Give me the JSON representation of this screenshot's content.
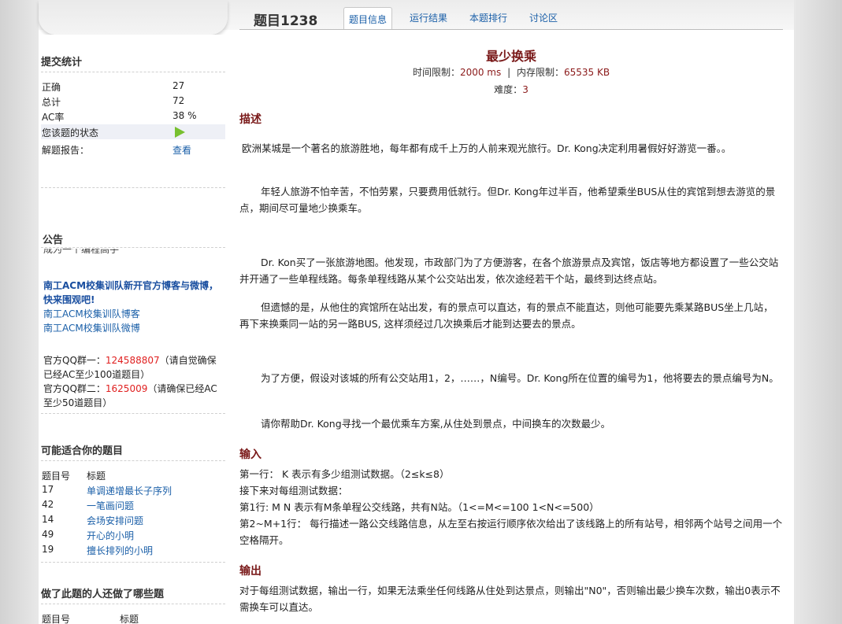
{
  "header": {
    "problem_id": "题目1238",
    "tabs": [
      {
        "label": "题目信息",
        "active": true
      },
      {
        "label": "运行结果",
        "active": false
      },
      {
        "label": "本题排行",
        "active": false
      },
      {
        "label": "讨论区",
        "active": false
      }
    ]
  },
  "stats": {
    "title": "提交统计",
    "rows": [
      {
        "label": "正确",
        "value": "27"
      },
      {
        "label": "总计",
        "value": "72"
      },
      {
        "label": "AC率",
        "value": "38 %"
      }
    ],
    "status_label": "您该题的状态",
    "report_label": "解题报告：",
    "report_link": "查看"
  },
  "notice": {
    "title": "公告",
    "cut_text": "成为一个编程高手",
    "links": [
      "南工ACM校集训队新开官方博客与微博，快来围观吧!",
      "南工ACM校集训队博客",
      "南工ACM校集训队微博"
    ],
    "qq1_label": "官方QQ群一：",
    "qq1_number": "124588807",
    "qq1_note": "（请自觉确保已经AC至少100道题目）",
    "qq2_label": "官方QQ群二：",
    "qq2_number": "1625009",
    "qq2_note": "（请确保已经AC至少50道题目）"
  },
  "suggested": {
    "title": "可能适合你的题目",
    "col_id": "题目号",
    "col_title": "标题",
    "rows": [
      {
        "id": "17",
        "title": "单调递增最长子序列"
      },
      {
        "id": "42",
        "title": "一笔画问题"
      },
      {
        "id": "14",
        "title": "会场安排问题"
      },
      {
        "id": "49",
        "title": "开心的小明"
      },
      {
        "id": "19",
        "title": "擅长排列的小明"
      }
    ]
  },
  "others": {
    "title": "做了此题的人还做了哪些题",
    "col_id": "题目号",
    "col_title": "标题"
  },
  "problem": {
    "title": "最少换乘",
    "time_label": "时间限制：",
    "time_value": "2000 ms",
    "sep": "|",
    "mem_label": "内存限制：",
    "mem_value": "65535 KB",
    "diff_label": "难度：",
    "diff_value": "3",
    "desc_heading": "描述",
    "desc": [
      "欧洲某城是一个著名的旅游胜地，每年都有成千上万的人前来观光旅行。Dr. Kong决定利用暑假好好游览一番。。",
      "年轻人旅游不怕辛苦，不怕劳累，只要费用低就行。但Dr. Kong年过半百，他希望乘坐BUS从住的宾馆到想去游览的景点，期间尽可量地少换乘车。",
      "Dr. Kon买了一张旅游地图。他发现，市政部门为了方便游客，在各个旅游景点及宾馆，饭店等地方都设置了一些公交站并开通了一些单程线路。每条单程线路从某个公交站出发，依次途经若干个站，最终到达终点站。",
      "但遗憾的是，从他住的宾馆所在站出发，有的景点可以直达，有的景点不能直达，则他可能要先乘某路BUS坐上几站，再下来换乘同一站的另一路BUS, 这样须经过几次换乘后才能到达要去的景点。",
      "为了方便，假设对该城的所有公交站用1，2，……，N编号。Dr. Kong所在位置的编号为1，他将要去的景点编号为N。",
      "请你帮助Dr. Kong寻找一个最优乘车方案,从住处到景点，中间换车的次数最少。"
    ],
    "input_heading": "输入",
    "input": [
      "第一行： K 表示有多少组测试数据。（2≤k≤8）",
      "接下来对每组测试数据：",
      "第1行: M N 表示有M条单程公交线路，共有N站。（1<=M<=100 1<N<=500）",
      "第2~M+1行： 每行描述一路公交线路信息，从左至右按运行顺序依次给出了该线路上的所有站号，相邻两个站号之间用一个空格隔开。"
    ],
    "output_heading": "输出",
    "output": [
      "对于每组测试数据，输出一行，如果无法乘坐任何线路从住处到达景点，则输出\"N0\"，否则输出最少换车次数，输出0表示不需换车可以直达。"
    ]
  }
}
